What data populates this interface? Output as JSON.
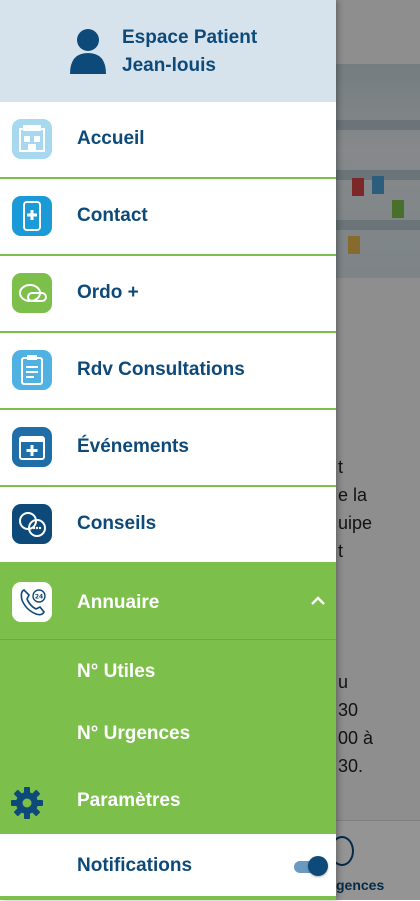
{
  "drawer": {
    "user_line1": "Espace Patient",
    "user_line2": "Jean-louis",
    "items": [
      {
        "label": "Accueil",
        "icon": "pharmacy-store-icon",
        "color": "#a7d8f0"
      },
      {
        "label": "Contact",
        "icon": "smartphone-cross-icon",
        "color": "#1a9ad6"
      },
      {
        "label": "Ordo +",
        "icon": "pills-icon",
        "color": "#7cc04b"
      },
      {
        "label": "Rdv Consultations",
        "icon": "clipboard-schedule-icon",
        "color": "#4fb2e3"
      },
      {
        "label": "Événements",
        "icon": "calendar-cross-icon",
        "color": "#1f6ea8"
      },
      {
        "label": "Conseils",
        "icon": "speech-bubbles-icon",
        "color": "#0d4a7a"
      }
    ],
    "annuaire": {
      "label": "Annuaire",
      "icon": "phone-24h-icon",
      "expanded": true,
      "sub_items": [
        "N° Utiles",
        "N° Urgences"
      ]
    },
    "parametres": {
      "label": "Paramètres",
      "icon": "gear-icon"
    },
    "notifications": {
      "label": "Notifications",
      "enabled": true
    },
    "accent": "#7cc04b",
    "text_color": "#0d4a7a"
  },
  "background": {
    "lines_top": [
      "t",
      "e la",
      "uipe",
      "t"
    ],
    "lines_bottom": [
      "u",
      "30",
      "00 à",
      "30."
    ],
    "bottom_nav_label": "gences"
  }
}
